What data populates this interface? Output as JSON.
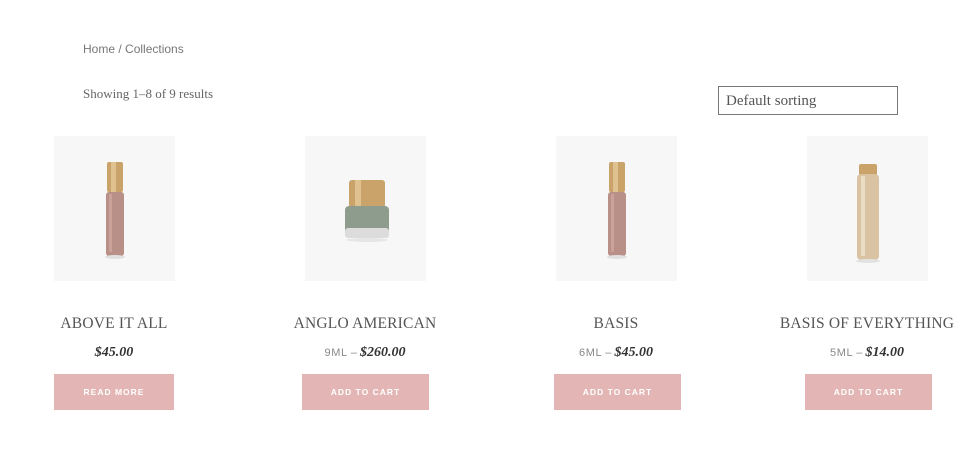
{
  "breadcrumb": {
    "home": "Home",
    "separator": " / ",
    "current": "Collections"
  },
  "results": {
    "text": "Showing 1–8 of 9 results"
  },
  "sorting": {
    "selected": "Default sorting"
  },
  "products": [
    {
      "title": "ABOVE IT ALL",
      "size": "",
      "price": "$45.00",
      "button": "READ MORE",
      "image": "liquid-foundation-bottle-nude",
      "color": "#b99088"
    },
    {
      "title": "ANGLO AMERICAN",
      "size": "9ML",
      "price": "$260.00",
      "button": "ADD TO CART",
      "image": "nail-polish-sage-green",
      "color": "#8e9c8d"
    },
    {
      "title": "BASIS",
      "size": "6ML",
      "price": "$45.00",
      "button": "ADD TO CART",
      "image": "liquid-foundation-bottle-nude",
      "color": "#b99088"
    },
    {
      "title": "BASIS OF EVERYTHING",
      "size": "5ML",
      "price": "$14.00",
      "button": "ADD TO CART",
      "image": "gold-primer-tube",
      "color": "#d9c3a3"
    }
  ],
  "colors": {
    "button_bg": "#e3b6b5",
    "thumb_bg": "#f7f7f7",
    "gold_cap": "#c9a36a"
  }
}
